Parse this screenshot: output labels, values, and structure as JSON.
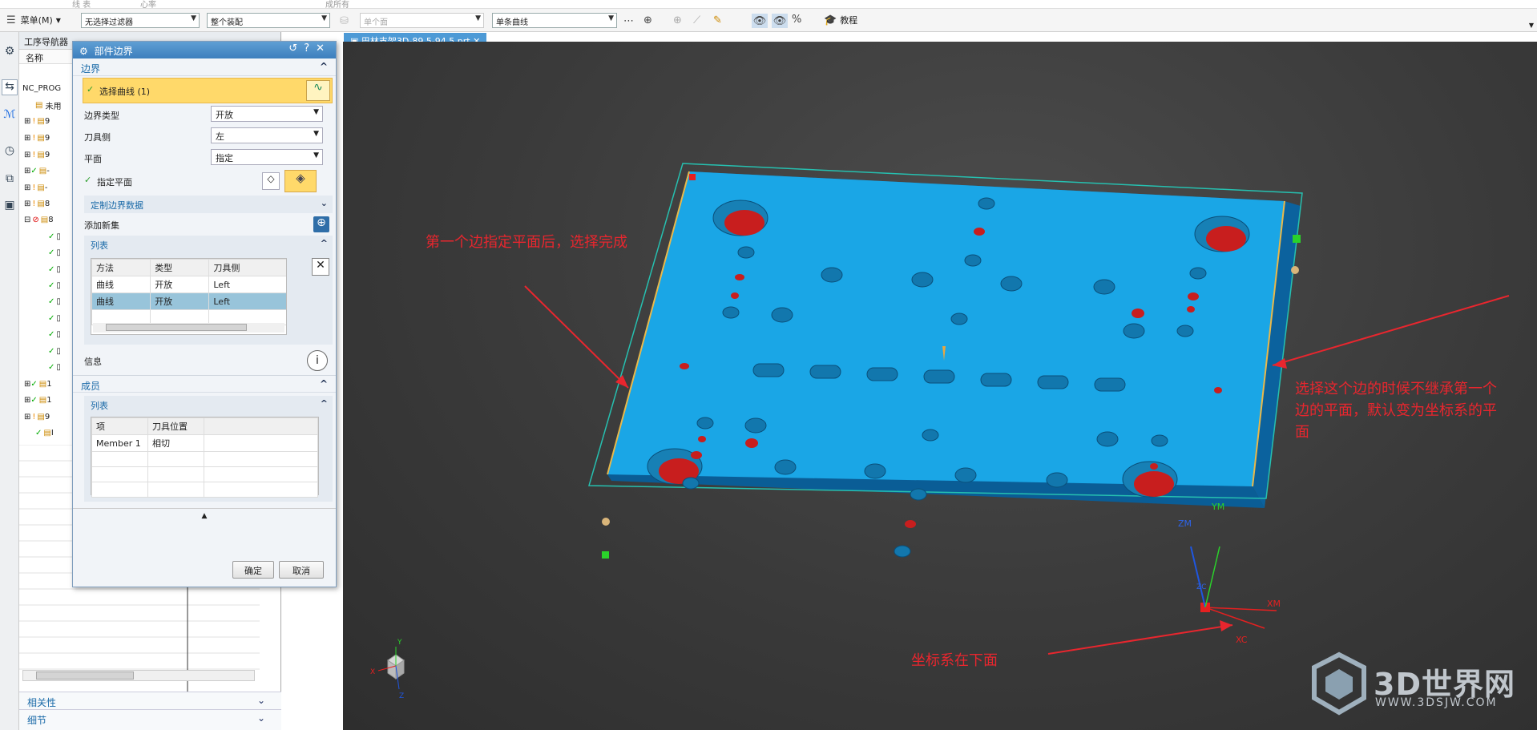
{
  "top_strip": {
    "left_text": "线 表",
    "mid_text": "心率",
    "right_text": "成所有"
  },
  "toolbar": {
    "menu_label": "菜单(M)",
    "filter_select": "无选择过滤器",
    "assembly_select": "整个装配",
    "face_select": "单个面",
    "curve_select": "单条曲线",
    "tutorial_label": "教程"
  },
  "navigator": {
    "title": "工序导航器",
    "col_name": "名称",
    "root": "NC_PROG",
    "unused": "未用",
    "row_fragments": [
      "9",
      "9",
      "9",
      "-",
      "-",
      "8",
      "8",
      "",
      "",
      "",
      "",
      "",
      "",
      "",
      "",
      "1",
      "1",
      "9",
      "I"
    ],
    "sections": [
      "相关性",
      "细节"
    ]
  },
  "dialog": {
    "title": "部件边界",
    "boundary_group": "边界",
    "select_curve": "选择曲线 (1)",
    "boundary_type_label": "边界类型",
    "boundary_type_value": "开放",
    "tool_side_label": "刀具侧",
    "tool_side_value": "左",
    "plane_label": "平面",
    "plane_value": "指定",
    "specify_plane": "指定平面",
    "custom_data": "定制边界数据",
    "add_new_set": "添加新集",
    "list_group": "列表",
    "list_headers": [
      "方法",
      "类型",
      "刀具侧"
    ],
    "list_rows": [
      [
        "曲线",
        "开放",
        "Left"
      ],
      [
        "曲线",
        "开放",
        "Left"
      ]
    ],
    "info_label": "信息",
    "members_group": "成员",
    "members_list_group": "列表",
    "members_headers": [
      "项",
      "刀具位置"
    ],
    "members_rows": [
      [
        "Member 1",
        "相切"
      ]
    ],
    "ok": "确定",
    "cancel": "取消"
  },
  "viewport": {
    "tab_label": "巴林支架3D-89.5-94.5.prt",
    "annot1": "第一个边指定平面后，选择完成",
    "annot2_lines": [
      "选择这个边的时候不继承第一个",
      "边的平面，默认变为坐标系的平",
      "面"
    ],
    "annot3": "坐标系在下面",
    "axis_labels": {
      "ym": "YM",
      "zm": "ZM",
      "xm": "XM",
      "xc": "XC",
      "zc": "ZC"
    },
    "triad_labels": {
      "x": "X",
      "y": "Y",
      "z": "Z"
    },
    "watermark_title": "3D世界网",
    "watermark_url": "WWW.3DSJW.COM"
  },
  "colors": {
    "part_top": "#1aa6e6",
    "part_side": "#0d6fb0",
    "hole_red": "#c81e1e",
    "annotation": "#e8262e",
    "accent": "#3d7fbd"
  }
}
